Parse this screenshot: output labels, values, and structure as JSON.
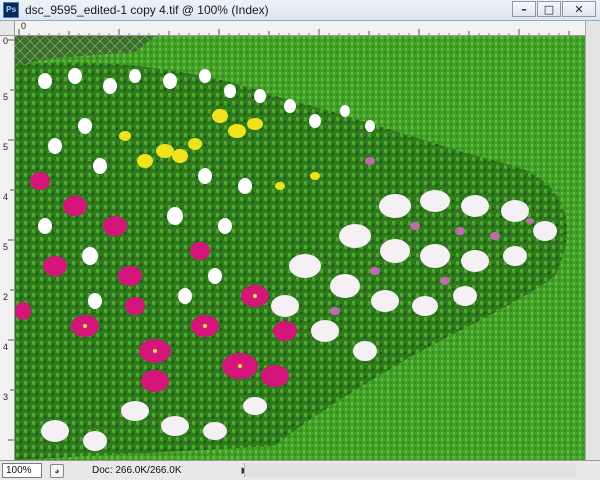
{
  "window": {
    "title": "dsc_9595_edited-1 copy 4.tif @ 100% (Index)",
    "app_icon_text": "Ps",
    "buttons": {
      "minimize": "–",
      "maximize": "□",
      "close": "✕"
    }
  },
  "rulers": {
    "top_origin_label": "0",
    "left_labels": [
      "0",
      "5",
      "5",
      "4",
      "5",
      "2",
      "4",
      "3",
      "2",
      "5"
    ]
  },
  "canvas": {
    "image_description_icon": "photo-canvas",
    "grass_color": "#4aa12a",
    "flower_colors": [
      "#d6167a",
      "#ffffff",
      "#f2e21f",
      "#c06ab0"
    ]
  },
  "status": {
    "zoom": "100%",
    "doc_info": "Doc: 266.0K/266.0K",
    "arrow": "▶"
  },
  "colors": {
    "titlebar": "#dce6f2",
    "ps_icon": "#0b2a53"
  }
}
